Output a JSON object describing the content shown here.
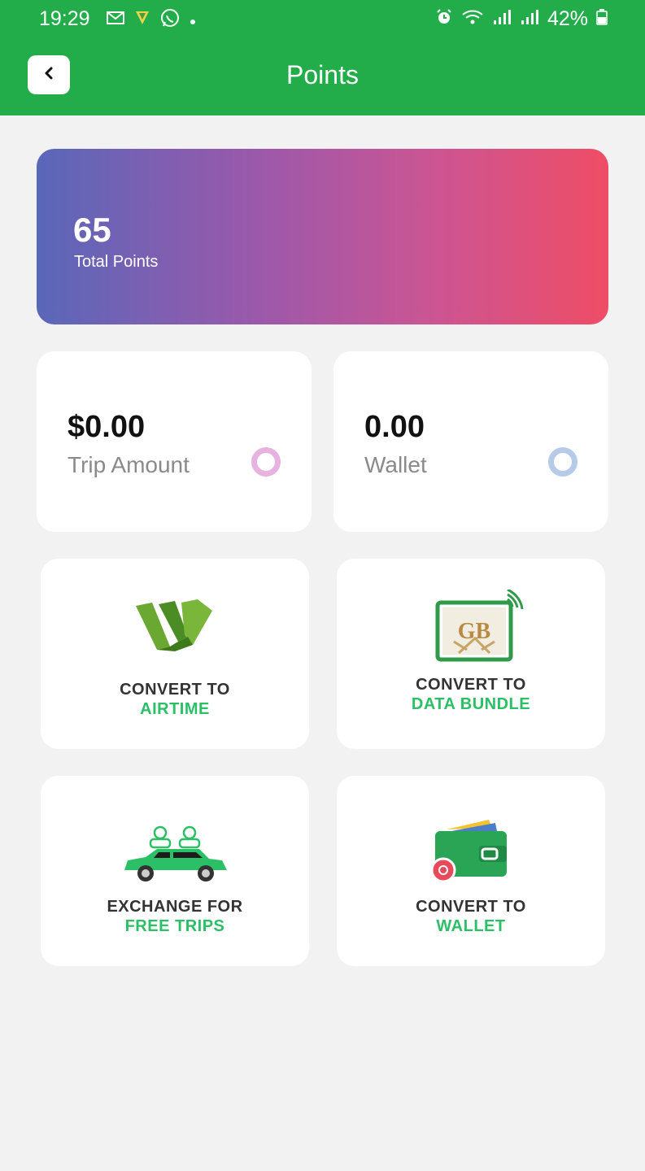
{
  "status_bar": {
    "time": "19:29",
    "battery": "42%",
    "notification_icons": [
      "gmail-icon",
      "vpn-shield-icon",
      "whatsapp-icon",
      "dot-icon"
    ],
    "system_icons": [
      "alarm-icon",
      "wifi-icon",
      "signal-icon",
      "signal-icon",
      "battery-icon"
    ]
  },
  "header": {
    "title": "Points",
    "back_icon": "chevron-left-icon",
    "background_color": "#22ad4a"
  },
  "points_card": {
    "value": "65",
    "label": "Total Points",
    "gradient": [
      "#5a67b9",
      "#ef4d66"
    ]
  },
  "stats": [
    {
      "value": "$0.00",
      "label": "Trip Amount",
      "ring_color": "#e6b3e0"
    },
    {
      "value": "0.00",
      "label": "Wallet",
      "ring_color": "#b5cbe8"
    }
  ],
  "actions": [
    {
      "line1": "CONVERT TO",
      "line2": "AIRTIME",
      "icon": "airtime-logo-icon"
    },
    {
      "line1": "CONVERT TO",
      "line2": "DATA BUNDLE",
      "icon": "data-bundle-icon",
      "icon_text": "GB"
    },
    {
      "line1": "EXCHANGE FOR",
      "line2": "FREE TRIPS",
      "icon": "car-passengers-icon"
    },
    {
      "line1": "CONVERT TO",
      "line2": "WALLET",
      "icon": "wallet-icon"
    }
  ],
  "colors": {
    "accent_green": "#2bbf66",
    "background": "#f2f2f2"
  }
}
